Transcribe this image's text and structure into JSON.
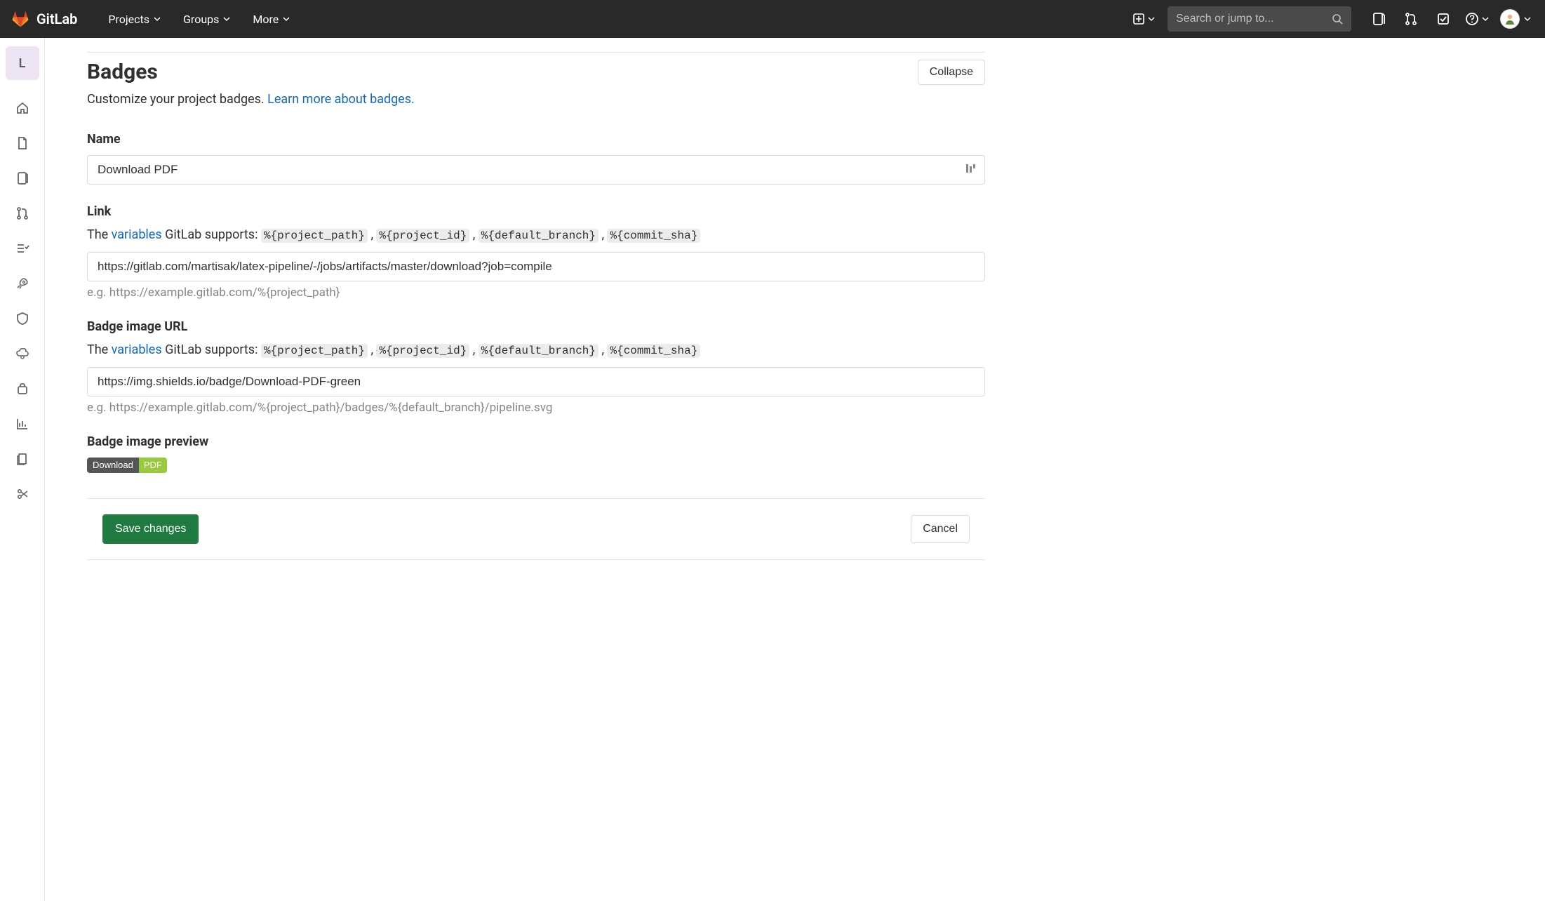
{
  "header": {
    "brand": "GitLab",
    "nav": {
      "projects": "Projects",
      "groups": "Groups",
      "more": "More"
    },
    "search_placeholder": "Search or jump to..."
  },
  "sidebar": {
    "project_letter": "L"
  },
  "section": {
    "title": "Badges",
    "collapse": "Collapse",
    "desc_prefix": "Customize your project badges. ",
    "desc_link": "Learn more about badges.",
    "name": {
      "label": "Name",
      "value": "Download PDF"
    },
    "link": {
      "label": "Link",
      "hint_pre": "The ",
      "hint_variables": "variables",
      "hint_post": " GitLab supports: ",
      "var1": "%{project_path}",
      "var2": "%{project_id}",
      "var3": "%{default_branch}",
      "var4": "%{commit_sha}",
      "value": "https://gitlab.com/martisak/latex-pipeline/-/jobs/artifacts/master/download?job=compile",
      "example": "e.g. https://example.gitlab.com/%{project_path}"
    },
    "image": {
      "label": "Badge image URL",
      "value": "https://img.shields.io/badge/Download-PDF-green",
      "example": "e.g. https://example.gitlab.com/%{project_path}/badges/%{default_branch}/pipeline.svg"
    },
    "preview": {
      "label": "Badge image preview",
      "left": "Download",
      "right": "PDF"
    },
    "actions": {
      "save": "Save changes",
      "cancel": "Cancel"
    }
  }
}
